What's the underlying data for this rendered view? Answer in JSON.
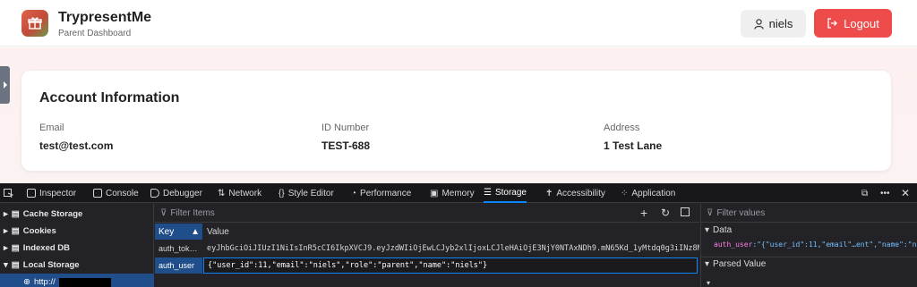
{
  "app": {
    "title": "TrypresentMe",
    "subtitle": "Parent Dashboard"
  },
  "header": {
    "user_label": "niels",
    "logout_label": "Logout"
  },
  "account": {
    "title": "Account Information",
    "fields": [
      {
        "label": "Email",
        "value": "test@test.com"
      },
      {
        "label": "ID Number",
        "value": "TEST-688"
      },
      {
        "label": "Address",
        "value": "1 Test Lane"
      }
    ]
  },
  "devtools": {
    "tabs": [
      "Inspector",
      "Console",
      "Debugger",
      "Network",
      "Style Editor",
      "Performance",
      "Memory",
      "Storage",
      "Accessibility",
      "Application"
    ],
    "active_tab": "Storage",
    "tree": {
      "items": [
        "Cache Storage",
        "Cookies",
        "Indexed DB",
        "Local Storage"
      ],
      "sub_item": "http://"
    },
    "table": {
      "filter_placeholder": "Filter Items",
      "col_key": "Key",
      "col_value": "Value",
      "rows": [
        {
          "key": "auth_tok…",
          "value": "eyJhbGciOiJIUzI1NiIsInR5cCI6IkpXVCJ9.eyJzdWIiOjEwLCJyb2xlIjoxLCJleHAiOjE3NjY0NTAxNDh9.mN65Kd_1yMtdq0g3iINz8Mp4jb-Ylc2…"
        },
        {
          "key": "auth_user",
          "value": "{\"user_id\":11,\"email\":\"niels\",\"role\":\"parent\",\"name\":\"niels\"}"
        }
      ]
    },
    "sidebar": {
      "filter_placeholder": "Filter values",
      "data_label": "Data",
      "data_key": "auth_user",
      "data_value": ":\"{\"user_id\":11,\"email\"…ent\",\"name\":\"niels\"}\"",
      "parsed_label": "Parsed Value"
    }
  },
  "colors": {
    "logout": "#ee4b4b",
    "devtools_bg": "#232327",
    "selection": "#204e8a",
    "accent": "#0a84ff"
  }
}
